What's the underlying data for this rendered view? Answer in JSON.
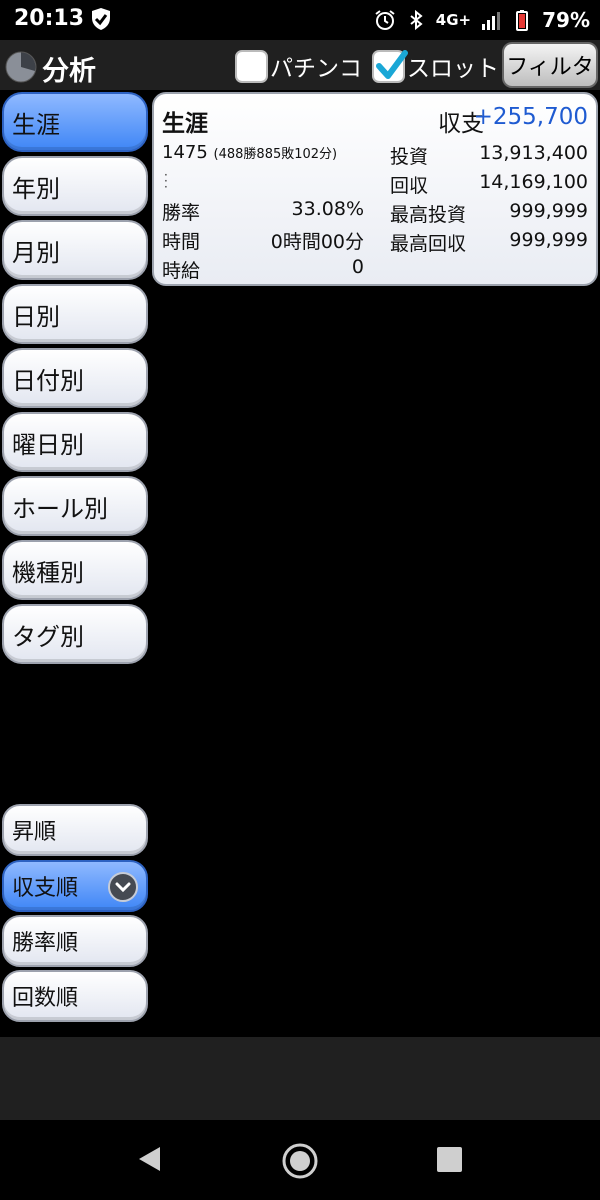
{
  "status_bar": {
    "time": "20:13",
    "network": "4G+",
    "battery": "79%"
  },
  "header": {
    "title": "分析",
    "checkboxes": [
      {
        "label": "パチンコ",
        "checked": false
      },
      {
        "label": "スロット",
        "checked": true
      }
    ],
    "filter_label": "フィルタ"
  },
  "sidebar": {
    "items": [
      {
        "label": "生涯",
        "active": true
      },
      {
        "label": "年別",
        "active": false
      },
      {
        "label": "月別",
        "active": false
      },
      {
        "label": "日別",
        "active": false
      },
      {
        "label": "日付別",
        "active": false
      },
      {
        "label": "曜日別",
        "active": false
      },
      {
        "label": "ホール別",
        "active": false
      },
      {
        "label": "機種別",
        "active": false
      },
      {
        "label": "タグ別",
        "active": false
      }
    ],
    "sort_items": [
      {
        "label": "昇順",
        "active": false
      },
      {
        "label": "収支順",
        "active": true
      },
      {
        "label": "勝率順",
        "active": false
      },
      {
        "label": "回数順",
        "active": false
      }
    ]
  },
  "card": {
    "title": "生涯",
    "balance_label": "収支",
    "balance_value": "+255,700",
    "games_count": "1475",
    "games_detail": "(488勝885敗102分)",
    "win_rate_label": "勝率",
    "win_rate_value": "33.08%",
    "time_label": "時間",
    "time_value": "0時間00分",
    "hourly_label": "時給",
    "hourly_value": "0",
    "invest_label": "投資",
    "invest_value": "13,913,400",
    "return_label": "回収",
    "return_value": "14,169,100",
    "max_invest_label": "最高投資",
    "max_invest_value": "999,999",
    "max_return_label": "最高回収",
    "max_return_value": "999,999"
  },
  "colors": {
    "accent_blue": "#3f86f6",
    "balance_blue": "#1f5bd1"
  }
}
